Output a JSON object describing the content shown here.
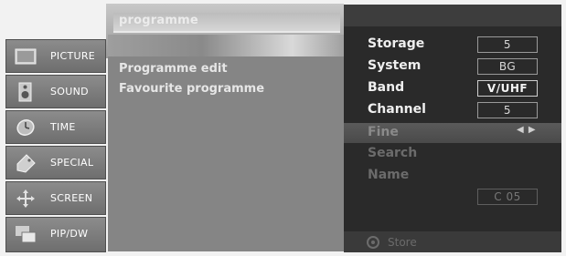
{
  "header": {
    "title": "programme"
  },
  "menu": {
    "items": [
      {
        "label": "PICTURE",
        "icon": "picture-icon"
      },
      {
        "label": "SOUND",
        "icon": "speaker-icon"
      },
      {
        "label": "TIME",
        "icon": "clock-icon"
      },
      {
        "label": "SPECIAL",
        "icon": "tag-icon"
      },
      {
        "label": "SCREEN",
        "icon": "move-arrows-icon"
      },
      {
        "label": "PIP/DW",
        "icon": "pip-icon"
      }
    ]
  },
  "submenu": {
    "items": [
      {
        "label": "Programme edit"
      },
      {
        "label": "Favourite programme"
      }
    ]
  },
  "settings": {
    "rows": [
      {
        "label": "Storage",
        "value": "5"
      },
      {
        "label": "System",
        "value": "BG"
      },
      {
        "label": "Band",
        "value": "V/UHF"
      },
      {
        "label": "Channel",
        "value": "5"
      },
      {
        "label": "Fine",
        "value": "◀ ▶"
      },
      {
        "label": "Search",
        "value": ""
      },
      {
        "label": "Name",
        "value": "C 05"
      }
    ],
    "store_label": "Store"
  }
}
